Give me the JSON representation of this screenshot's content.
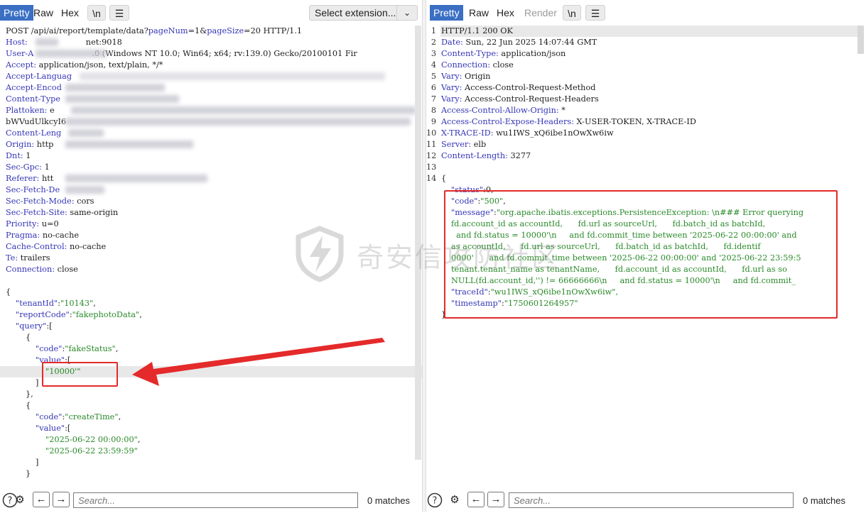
{
  "request_panel": {
    "tabs": {
      "pretty": "Pretty",
      "raw": "Raw",
      "hex": "Hex"
    },
    "newline_toggle": "\\n",
    "menu_icon": "menu-icon",
    "extension_select": "Select extension...",
    "request_line": {
      "method": "POST",
      "path": "/api/ai/report/template/data?",
      "p1": "pageNum",
      "v1": "1",
      "p2": "pageSize",
      "v2": "20",
      "proto": "HTTP/1.1"
    },
    "headers": [
      {
        "name": "Host:",
        "value": "net:9018"
      },
      {
        "name": "User-A",
        "value": ".0 (Windows NT 10.0; Win64; x64; rv:139.0) Gecko/20100101 Fir"
      },
      {
        "name": "Accept:",
        "value": "application/json, text/plain, */*"
      },
      {
        "name": "Accept-Languag",
        "value": ""
      },
      {
        "name": "Accept-Encod",
        "value": ""
      },
      {
        "name": "Content-Type",
        "value": ""
      },
      {
        "name": "Plattoken:",
        "value": "e"
      },
      {
        "name": "",
        "value": "bWVudUlkcyI6"
      },
      {
        "name": "Content-Leng",
        "value": ""
      },
      {
        "name": "Origin:",
        "value": "http"
      },
      {
        "name": "Dnt:",
        "value": "1"
      },
      {
        "name": "Sec-Gpc:",
        "value": "1"
      },
      {
        "name": "Referer:",
        "value": "htt"
      },
      {
        "name": "Sec-Fetch-De",
        "value": ""
      },
      {
        "name": "Sec-Fetch-Mode:",
        "value": "cors"
      },
      {
        "name": "Sec-Fetch-Site:",
        "value": "same-origin"
      },
      {
        "name": "Priority:",
        "value": "u=0"
      },
      {
        "name": "Pragma:",
        "value": "no-cache"
      },
      {
        "name": "Cache-Control:",
        "value": "no-cache"
      },
      {
        "name": "Te:",
        "value": "trailers"
      },
      {
        "name": "Connection:",
        "value": "close"
      }
    ],
    "body": {
      "open": "{",
      "tenantId_key": "\"tenantId\"",
      "tenantId_val": "\"10143\"",
      "reportCode_key": "\"reportCode\"",
      "reportCode_val": "\"fakephotoData\"",
      "query_key": "\"query\"",
      "code_key": "\"code\"",
      "value_key": "\"value\"",
      "q1_code": "\"fakeStatus\"",
      "q1_value": "\"10000'\"",
      "q2_code": "\"createTime\"",
      "q2_v1": "\"2025-06-22 00:00:00\"",
      "q2_v2": "\"2025-06-22 23:59:59\""
    },
    "footer": {
      "search_placeholder": "Search...",
      "matches": "0 matches"
    }
  },
  "response_panel": {
    "tabs": {
      "pretty": "Pretty",
      "raw": "Raw",
      "hex": "Hex",
      "render": "Render"
    },
    "newline_toggle": "\\n",
    "line_numbers": [
      "1",
      "2",
      "3",
      "4",
      "5",
      "6",
      "7",
      "8",
      "9",
      "10",
      "11",
      "12",
      "13",
      "14"
    ],
    "status_line": "HTTP/1.1 200 OK",
    "headers": [
      {
        "name": "Date:",
        "value": "Sun, 22 Jun 2025 14:07:44 GMT"
      },
      {
        "name": "Content-Type:",
        "value": "application/json"
      },
      {
        "name": "Connection:",
        "value": "close"
      },
      {
        "name": "Vary:",
        "value": "Origin"
      },
      {
        "name": "Vary:",
        "value": "Access-Control-Request-Method"
      },
      {
        "name": "Vary:",
        "value": "Access-Control-Request-Headers"
      },
      {
        "name": "Access-Control-Allow-Origin:",
        "value": "*"
      },
      {
        "name": "Access-Control-Expose-Headers:",
        "value": "X-USER-TOKEN, X-TRACE-ID"
      },
      {
        "name": "X-TRACE-ID:",
        "value": "wu1IWS_xQ6ibe1nOwXw6iw"
      },
      {
        "name": "Server:",
        "value": "elb"
      },
      {
        "name": "Content-Length:",
        "value": "3277"
      }
    ],
    "json": {
      "open": "{",
      "status_key": "\"status\"",
      "status_val": "0,",
      "code_key": "\"code\"",
      "code_val": "\"500\"",
      "message_key": "\"message\"",
      "message_val": "\"org.apache.ibatis.exceptions.PersistenceException: \\n### Error querying",
      "wrap1": "fd.account_id as accountId,      fd.url as sourceUrl,      fd.batch_id as batchId,",
      "wrap2": "  and fd.status = 10000'\\n     and fd.commit_time between '2025-06-22 00:00:00' and",
      "wrap3": "as accountId,      fd.url as sourceUrl,      fd.batch_id as batchId,      fd.identif",
      "wrap4": "0000'      and fd.commit_time between '2025-06-22 00:00:00' and '2025-06-22 23:59:5",
      "wrap5": "tenant.tenant_name as tenantName,      fd.account_id as accountId,      fd.url as so",
      "wrap6": "NULL(fd.account_id,'') != 66666666\\n     and fd.status = 10000'\\n     and fd.commit_",
      "traceId_key": "\"traceId\"",
      "traceId_val": "\"wu1IWS_xQ6ibe1nOwXw6iw\",",
      "timestamp_key": "\"timestamp\"",
      "timestamp_val": "\"1750601264957\"",
      "close": "}"
    },
    "footer": {
      "search_placeholder": "Search...",
      "matches": "0 matches"
    }
  },
  "watermark": "奇安信攻防社区",
  "colors": {
    "active_tab": "#3a6fc4",
    "highlight": "#e42a2a",
    "key": "#3535b8",
    "string": "#2a8a2a"
  }
}
